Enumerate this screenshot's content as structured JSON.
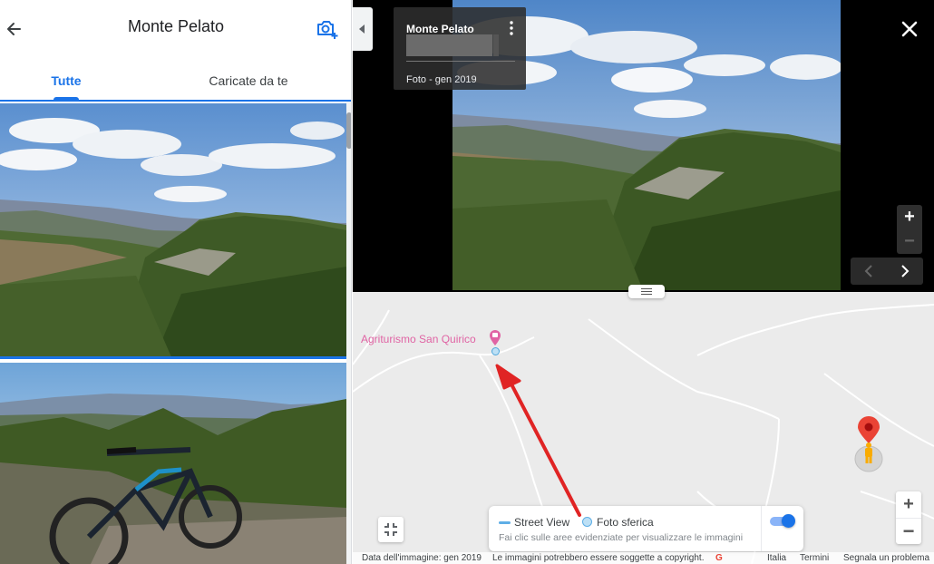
{
  "left_panel": {
    "title": "Monte Pelato",
    "tabs": [
      {
        "label": "Tutte"
      },
      {
        "label": "Caricate da te"
      }
    ]
  },
  "viewer": {
    "info_title": "Monte Pelato",
    "info_subtitle": "Foto - gen 2019",
    "zoom_in": "+",
    "zoom_out": "−"
  },
  "map": {
    "poi_name": "Agriturismo San Quirico",
    "legend": {
      "street_view": "Street View",
      "spherical_photo": "Foto sferica",
      "hint": "Fai clic sulle aree evidenziate per visualizzare le immagini"
    },
    "zoom_in": "+",
    "zoom_out": "−",
    "footer": {
      "image_date": "Data dell'immagine: gen 2019",
      "copyright": "Le immagini potrebbero essere soggette a copyright.",
      "logo": "G",
      "country": "Italia",
      "terms": "Termini",
      "report": "Segnala un problema"
    }
  },
  "colors": {
    "accent": "#1a73e8",
    "poi_pink": "#e064a4",
    "arrow_red": "#e02424"
  }
}
